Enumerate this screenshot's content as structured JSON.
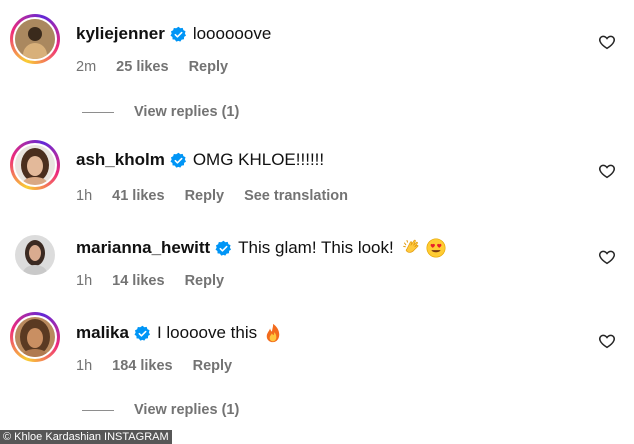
{
  "comments": [
    {
      "username": "kyliejenner",
      "text": "loooooove",
      "time": "2m",
      "likes": "25 likes",
      "reply": "Reply",
      "avatar_icon": "avatar-kyliejenner",
      "story_ring": true
    },
    {
      "username": "ash_kholm",
      "text": "OMG KHLOE!!!!!!",
      "time": "1h",
      "likes": "41 likes",
      "reply": "Reply",
      "translation": "See translation",
      "avatar_icon": "avatar-ash-kholm",
      "story_ring": true
    },
    {
      "username": "marianna_hewitt",
      "text": "This glam! This look!",
      "emojis": [
        "clapping-hands-emoji",
        "heart-eyes-emoji"
      ],
      "time": "1h",
      "likes": "14 likes",
      "reply": "Reply",
      "avatar_icon": "avatar-marianna-hewitt",
      "story_ring": false
    },
    {
      "username": "malika",
      "text": "I loooove this",
      "emojis": [
        "fire-emoji"
      ],
      "time": "1h",
      "likes": "184 likes",
      "reply": "Reply",
      "avatar_icon": "avatar-malika",
      "story_ring": true
    }
  ],
  "view_replies": [
    {
      "label": "View replies (1)"
    },
    {
      "label": "View replies (1)"
    }
  ],
  "icons": {
    "verified": "verified-badge-icon",
    "like": "heart-outline-icon"
  },
  "colors": {
    "verified_blue": "#0095f6",
    "meta_gray": "#737373",
    "ring_start": "#f9ce34",
    "ring_mid": "#ee2a7b",
    "ring_end": "#6228d7"
  },
  "credit": "© Khloe Kardashian INSTAGRAM"
}
